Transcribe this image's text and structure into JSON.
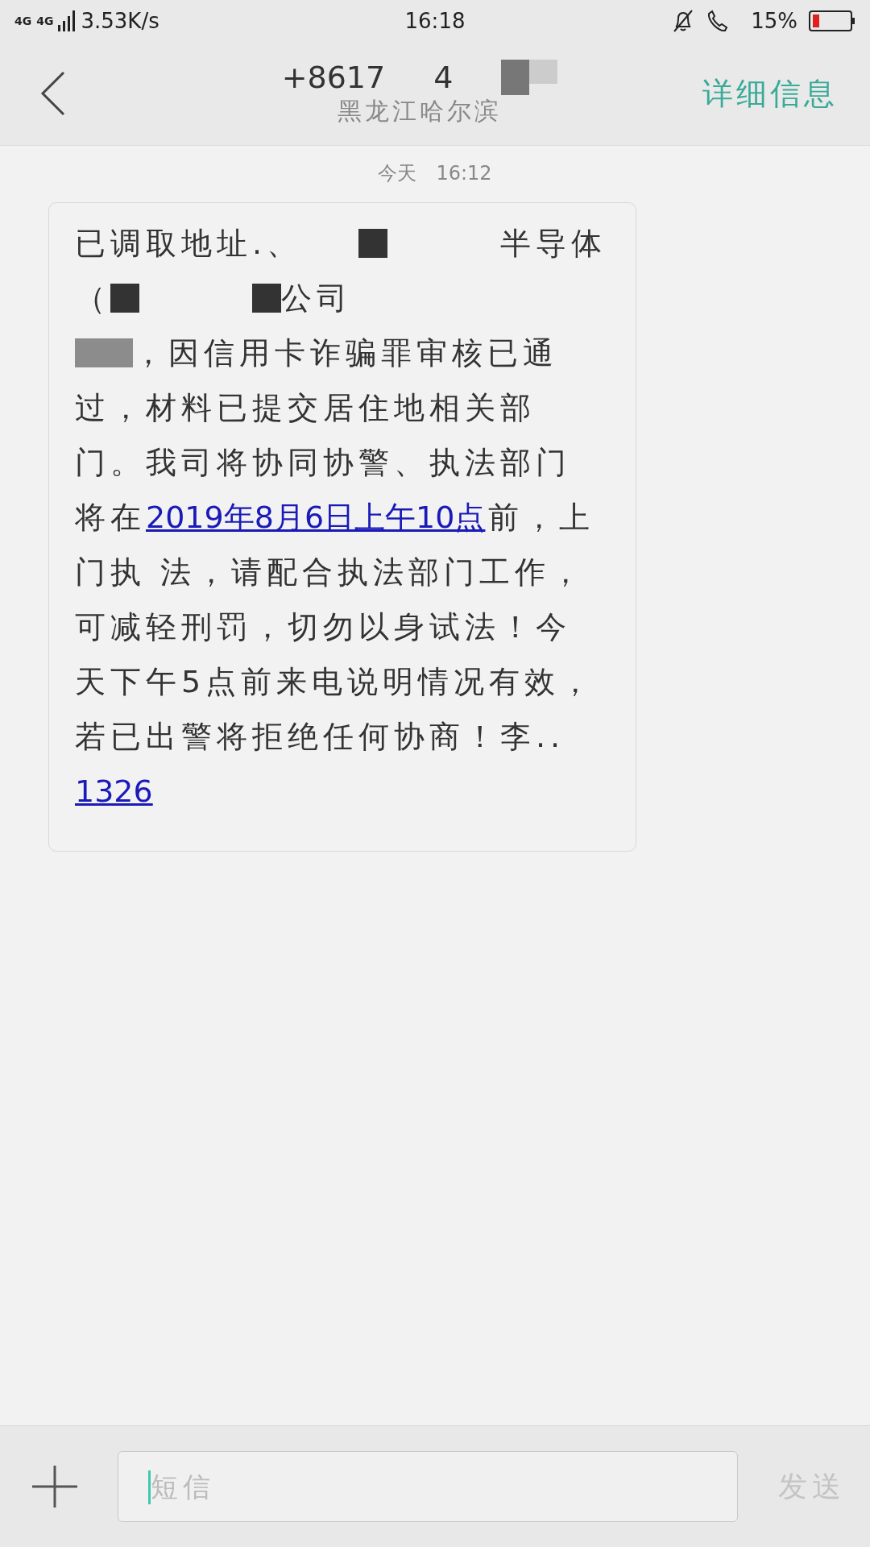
{
  "status_bar": {
    "network": "4G",
    "network_2": "4G",
    "speed": "3.53K/s",
    "time": "16:18",
    "battery": "15%"
  },
  "header": {
    "title": "+8617",
    "title_tail": "4",
    "subtitle": "黑龙江哈尔滨",
    "action": "详细信息"
  },
  "date_label": "今天　16:12",
  "message": {
    "lines": [
      [
        {
          "kind": "text",
          "text": "已调取地址.、"
        },
        {
          "kind": "blank"
        },
        {
          "kind": "redacted-dark"
        },
        {
          "kind": "blank"
        },
        {
          "kind": "blank"
        },
        {
          "kind": "text",
          "text": "半导体"
        }
      ],
      [
        {
          "kind": "text",
          "text": "（"
        },
        {
          "kind": "redacted-dark"
        },
        {
          "kind": "blank"
        },
        {
          "kind": "blank"
        },
        {
          "kind": "redacted-dark"
        },
        {
          "kind": "text",
          "text": "公司"
        }
      ],
      [
        {
          "kind": "redacted-blur"
        },
        {
          "kind": "text",
          "text": "，因信用卡诈骗罪审核已通"
        }
      ],
      [
        {
          "kind": "text",
          "text": "过，材料已提交居住地相关部"
        }
      ],
      [
        {
          "kind": "text",
          "text": "门。我司将协同协警、执法部门"
        }
      ],
      [
        {
          "kind": "text",
          "text": "将在"
        },
        {
          "kind": "link",
          "text": "2019年8月6日上午10点"
        },
        {
          "kind": "text",
          "text": "前，上"
        }
      ],
      [
        {
          "kind": "text",
          "text": "门执 法，请配合执法部门工作，"
        }
      ],
      [
        {
          "kind": "text",
          "text": "可减轻刑罚，切勿以身试法！今"
        }
      ],
      [
        {
          "kind": "text",
          "text": "天下午5点前来电说明情况有效，"
        }
      ],
      [
        {
          "kind": "text",
          "text": "若已出警将拒绝任何协商！李.."
        }
      ],
      [
        {
          "kind": "link",
          "text": "1326"
        }
      ]
    ]
  },
  "composer": {
    "placeholder": "短信",
    "send": "发送"
  }
}
